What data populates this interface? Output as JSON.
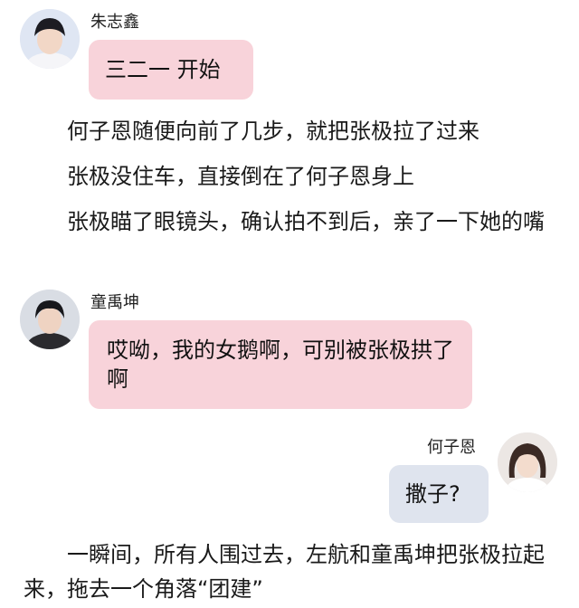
{
  "messages": [
    {
      "speaker": "朱志鑫",
      "text": "三二一 开始"
    },
    {
      "speaker": "童禹坤",
      "text": "哎呦，我的女鹅啊，可别被张极拱了啊"
    },
    {
      "speaker": "何子恩",
      "text": "撒子?"
    }
  ],
  "narration": [
    "何子恩随便向前了几步，就把张极拉了过来",
    "张极没住车，直接倒在了何子恩身上",
    "张极瞄了眼镜头，确认拍不到后，亲了一下她的嘴",
    "一瞬间，所有人围过去，左航和童禹坤把张极拉起来，拖去一个角落“团建”"
  ],
  "colors": {
    "left_bubble": "#f8d3da",
    "right_bubble": "#dfe4ee",
    "background": "#ffffff"
  }
}
